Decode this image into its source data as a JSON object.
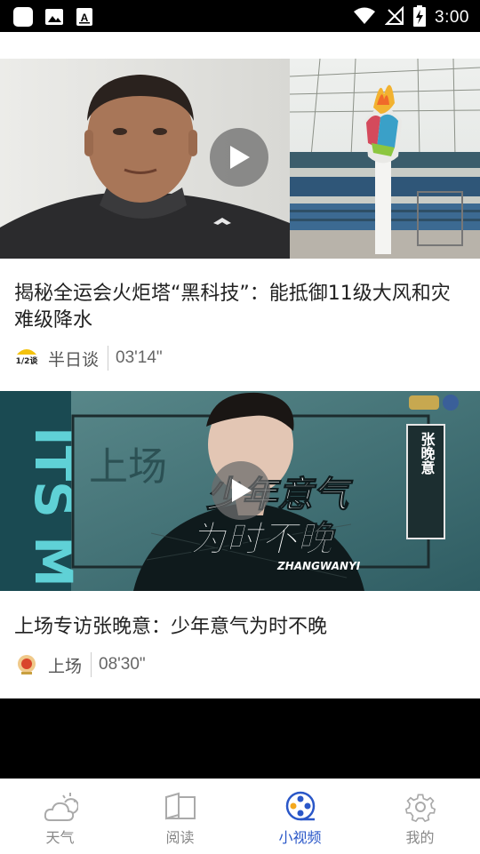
{
  "status_bar": {
    "time": "3:00",
    "left_icons": [
      "app-square-icon",
      "image-icon",
      "text-a-icon"
    ],
    "right_icons": [
      "wifi-icon",
      "no-signal-icon",
      "battery-charging-icon"
    ]
  },
  "feed": [
    {
      "title": "揭秘全运会火炬塔“黑科技”：能抵御11级大风和灾难级降水",
      "source": "半日谈",
      "duration": "03'14\"",
      "avatar_text": "1/2谈"
    },
    {
      "title": "上场专访张晚意：少年意气为时不晚",
      "source": "上场",
      "duration": "08'30\"",
      "thumb_texts": {
        "side_vertical": "张晚意",
        "headline_line1": "少年意气",
        "headline_line2": "为时不晚",
        "romanized": "ZHANGWANYI",
        "left_art": "ITS ME",
        "watermark": "上场"
      }
    }
  ],
  "bottom_nav": [
    {
      "label": "天气",
      "icon": "weather-icon",
      "active": false
    },
    {
      "label": "阅读",
      "icon": "book-icon",
      "active": false
    },
    {
      "label": "小视频",
      "icon": "film-reel-icon",
      "active": true
    },
    {
      "label": "我的",
      "icon": "gear-icon",
      "active": false
    }
  ],
  "colors": {
    "accent": "#2a57c8",
    "nav_inactive": "#888888",
    "title_text": "#222222"
  }
}
